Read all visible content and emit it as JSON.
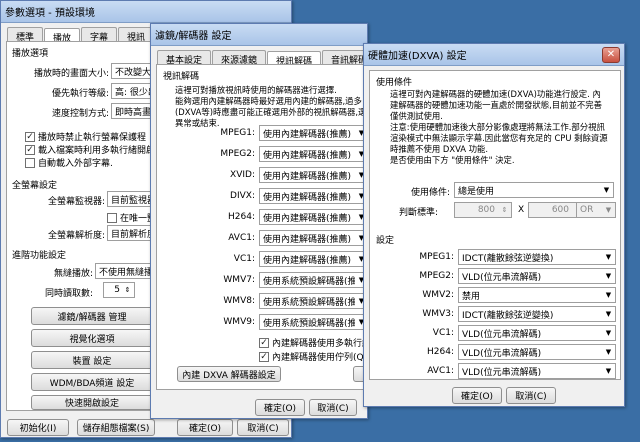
{
  "win1": {
    "title": "參數選項 - 預設環境",
    "tabs": [
      "標準",
      "播放",
      "字幕",
      "視訊"
    ],
    "section_playback": "播放選項",
    "label_screen_size": "播放時的畫面大小:",
    "value_screen_size": "不改變大小",
    "label_priority": "優先執行等級:",
    "value_priority": "高: 很少出",
    "label_speed": "速度控制方式:",
    "value_speed": "即時高畫質",
    "chk_screensaver": "播放時禁止執行螢幕保護程",
    "chk_multithread": "載入檔案時利用多執行緒開啟",
    "chk_subtitle": "自動載入外部字幕.",
    "section_fullscreen": "全螢幕設定",
    "label_monitor": "全螢幕監視器:",
    "value_monitor": "目前監視器",
    "chk_one_monitor": "在唯一監",
    "label_resolution": "全螢幕解析度:",
    "value_resolution": "目前解析度",
    "section_advanced": "進階功能設定",
    "label_seamless": "無縫播放:",
    "value_seamless": "不使用無縫播放",
    "label_sync": "同時讀取數:",
    "value_sync": "5",
    "btn_filter": "濾鏡/解碼器 管理",
    "btn_visual": "視覺化選項",
    "btn_device": "裝置 設定",
    "btn_wdm": "WDM/BDA頻道 設定",
    "btn_quickopen": "快速開啟設定",
    "btn_init": "初始化(I)",
    "btn_save_profile": "儲存組態檔案(S)",
    "btn_ok": "確定(O)",
    "btn_cancel": "取消(C)"
  },
  "win2": {
    "title": "濾鏡/解碼器 設定",
    "tabs": [
      "基本設定",
      "來源濾鏡",
      "視訊解碼",
      "音訊解碼"
    ],
    "section": "視訊解碼",
    "desc": [
      "這裡可對播放視訊時使用的解碼器進行選擇.",
      "能夠選用內建解碼器時最好選用內建的解碼器,過多",
      "(DXVA等)時應盡可能正確選用外部的視訊解碼器,選擇",
      "異常或結束."
    ],
    "codecs": [
      {
        "label": "MPEG1:",
        "value": "使用內建解碼器(推薦)"
      },
      {
        "label": "MPEG2:",
        "value": "使用內建解碼器(推薦)"
      },
      {
        "label": "XVID:",
        "value": "使用內建解碼器(推薦)"
      },
      {
        "label": "DIVX:",
        "value": "使用內建解碼器(推薦)"
      },
      {
        "label": "H264:",
        "value": "使用內建解碼器(推薦)"
      },
      {
        "label": "AVC1:",
        "value": "使用內建解碼器(推薦)"
      },
      {
        "label": "VC1:",
        "value": "使用內建解碼器(推薦)"
      },
      {
        "label": "WMV7:",
        "value": "使用系統預設解碼器(推薦)"
      },
      {
        "label": "WMV8:",
        "value": "使用系統預設解碼器(推薦)"
      },
      {
        "label": "WMV9:",
        "value": "使用系統預設解碼器(推薦)"
      }
    ],
    "chk_multithread": "內建解碼器使用多執行緒",
    "chk_queue": "內建解碼器使用佇列(Que",
    "btn_dxva": "內建 DXVA 解碼器設定",
    "btn_partial": "通",
    "btn_ok": "確定(O)",
    "btn_cancel": "取消(C)"
  },
  "win3": {
    "title": "硬體加速(DXVA) 設定",
    "section_conditions": "使用條件",
    "desc": [
      "這裡可對內建解碼器的硬體加速(DXVA)功能進行設定. 內",
      "建解碼器的硬體加速功能一直處於開發狀態,目前並不完善",
      "僅供測試使用.",
      "注意:使用硬體加速後大部分影像處理將無法工作.部分視訊",
      "渲染模式中無法顯示字幕.因此當您有充足的 CPU 剩餘資源",
      "時推薦不使用 DXVA 功能.",
      "是否使用由下方 \"使用條件\" 決定."
    ],
    "label_condition": "使用條件:",
    "value_condition": "總是使用",
    "label_criteria": "判斷標準:",
    "value_width": "800",
    "label_x": "X",
    "value_height": "600",
    "value_or": "OR",
    "section_settings": "設定",
    "codecs": [
      {
        "label": "MPEG1:",
        "value": "IDCT(離散餘弦逆變換)"
      },
      {
        "label": "MPEG2:",
        "value": "VLD(位元串流解碼)"
      },
      {
        "label": "WMV2:",
        "value": "禁用"
      },
      {
        "label": "WMV3:",
        "value": "IDCT(離散餘弦逆變換)"
      },
      {
        "label": "VC1:",
        "value": "VLD(位元串流解碼)"
      },
      {
        "label": "H264:",
        "value": "VLD(位元串流解碼)"
      },
      {
        "label": "AVC1:",
        "value": "VLD(位元串流解碼)"
      }
    ],
    "btn_ok": "確定(O)",
    "btn_cancel": "取消(C)"
  }
}
